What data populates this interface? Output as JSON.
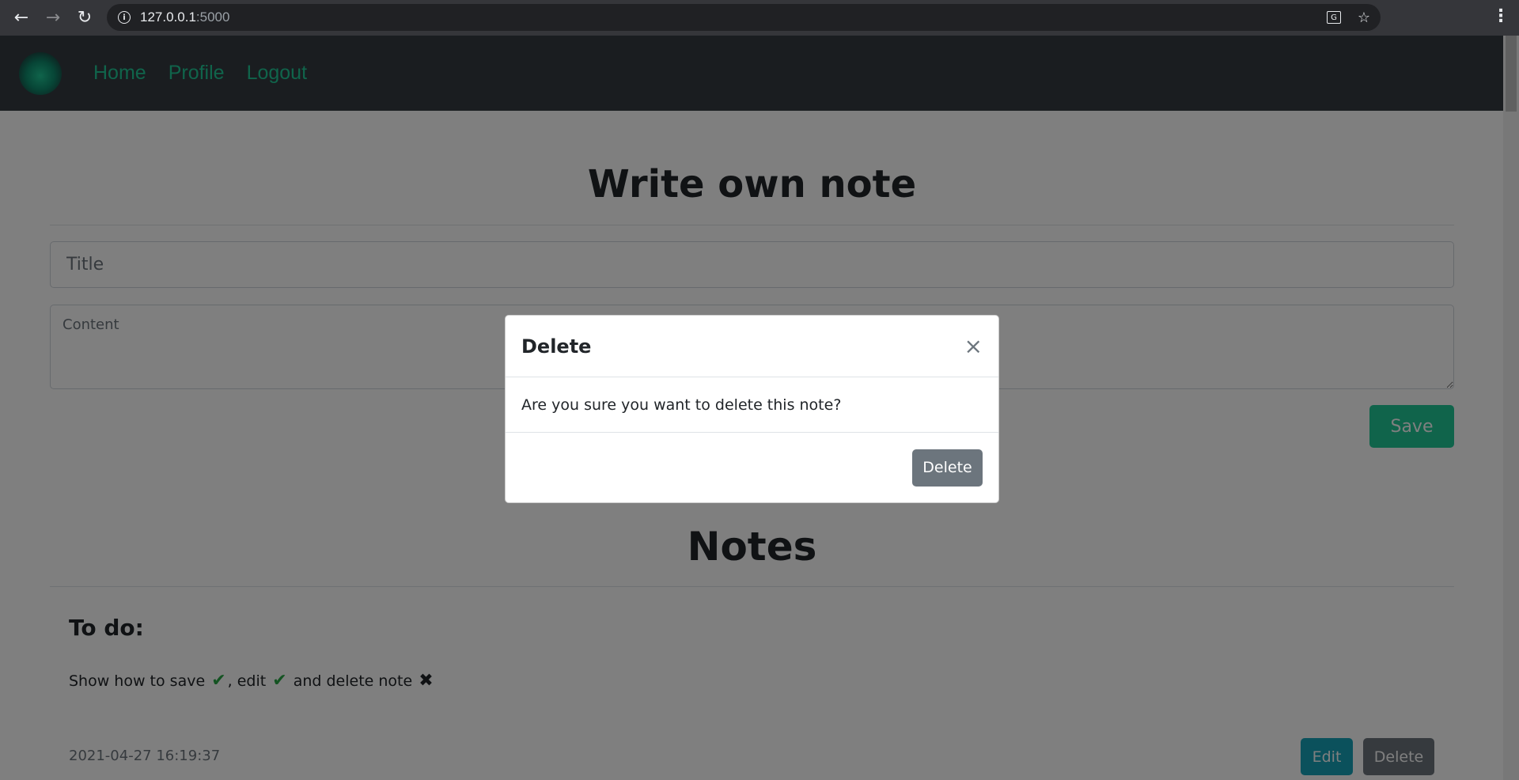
{
  "browser": {
    "url_host": "127.0.0.1",
    "url_port": ":5000",
    "back_icon": "←",
    "forward_icon": "→",
    "reload_icon": "↻",
    "info_icon": "i",
    "translate_icon": "G",
    "star_icon": "☆",
    "menu_icon": "⋮"
  },
  "navbar": {
    "links": [
      {
        "label": "Home"
      },
      {
        "label": "Profile"
      },
      {
        "label": "Logout"
      }
    ],
    "link_color": "#20c997",
    "bg_color": "#343a40"
  },
  "form": {
    "heading": "Write own note",
    "title_placeholder": "Title",
    "content_placeholder": "Content",
    "save_label": "Save"
  },
  "notes": {
    "heading": "Notes",
    "items": [
      {
        "title": "To do:",
        "content_part1": "Show how to save ",
        "content_part2": ", edit ",
        "content_part3": " and delete note",
        "check_glyph": "✔",
        "cross_glyph": "✖",
        "date": "2021-04-27 16:19:37",
        "edit_label": "Edit",
        "delete_label": "Delete"
      }
    ]
  },
  "modal": {
    "title": "Delete",
    "close_glyph": "×",
    "body": "Are you sure you want to delete this note?",
    "delete_label": "Delete"
  }
}
